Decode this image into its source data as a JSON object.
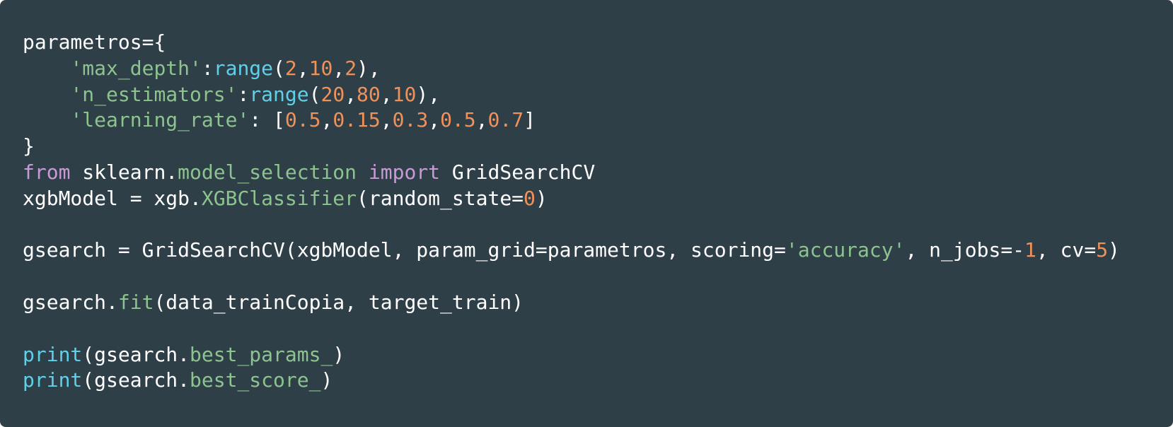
{
  "code_block": {
    "language": "python",
    "colors": {
      "background": "#2f3f48",
      "default": "#ffffff",
      "keyword": "#c99ad6",
      "string": "#8dc38f",
      "number": "#f0915a",
      "builtin": "#5fd0e8",
      "attribute": "#8dc38f"
    },
    "lines": [
      [
        {
          "t": "default",
          "text": "parametros={"
        }
      ],
      [
        {
          "t": "default",
          "text": "    "
        },
        {
          "t": "string",
          "text": "'max_depth'"
        },
        {
          "t": "default",
          "text": ":"
        },
        {
          "t": "builtin",
          "text": "range"
        },
        {
          "t": "default",
          "text": "("
        },
        {
          "t": "number",
          "text": "2"
        },
        {
          "t": "default",
          "text": ","
        },
        {
          "t": "number",
          "text": "10"
        },
        {
          "t": "default",
          "text": ","
        },
        {
          "t": "number",
          "text": "2"
        },
        {
          "t": "default",
          "text": "),"
        }
      ],
      [
        {
          "t": "default",
          "text": "    "
        },
        {
          "t": "string",
          "text": "'n_estimators'"
        },
        {
          "t": "default",
          "text": ":"
        },
        {
          "t": "builtin",
          "text": "range"
        },
        {
          "t": "default",
          "text": "("
        },
        {
          "t": "number",
          "text": "20"
        },
        {
          "t": "default",
          "text": ","
        },
        {
          "t": "number",
          "text": "80"
        },
        {
          "t": "default",
          "text": ","
        },
        {
          "t": "number",
          "text": "10"
        },
        {
          "t": "default",
          "text": "),"
        }
      ],
      [
        {
          "t": "default",
          "text": "    "
        },
        {
          "t": "string",
          "text": "'learning_rate'"
        },
        {
          "t": "default",
          "text": ": ["
        },
        {
          "t": "number",
          "text": "0.5"
        },
        {
          "t": "default",
          "text": ","
        },
        {
          "t": "number",
          "text": "0.15"
        },
        {
          "t": "default",
          "text": ","
        },
        {
          "t": "number",
          "text": "0.3"
        },
        {
          "t": "default",
          "text": ","
        },
        {
          "t": "number",
          "text": "0.5"
        },
        {
          "t": "default",
          "text": ","
        },
        {
          "t": "number",
          "text": "0.7"
        },
        {
          "t": "default",
          "text": "]"
        }
      ],
      [
        {
          "t": "default",
          "text": "}"
        }
      ],
      [
        {
          "t": "keyword",
          "text": "from"
        },
        {
          "t": "default",
          "text": " sklearn."
        },
        {
          "t": "attr",
          "text": "model_selection"
        },
        {
          "t": "default",
          "text": " "
        },
        {
          "t": "keyword",
          "text": "import"
        },
        {
          "t": "default",
          "text": " GridSearchCV"
        }
      ],
      [
        {
          "t": "default",
          "text": "xgbModel = xgb."
        },
        {
          "t": "attr",
          "text": "XGBClassifier"
        },
        {
          "t": "default",
          "text": "(random_state="
        },
        {
          "t": "number",
          "text": "0"
        },
        {
          "t": "default",
          "text": ")"
        }
      ],
      [],
      [
        {
          "t": "default",
          "text": "gsearch = GridSearchCV(xgbModel, param_grid=parametros, scoring="
        },
        {
          "t": "string",
          "text": "'accuracy'"
        },
        {
          "t": "default",
          "text": ", n_jobs=-"
        },
        {
          "t": "number",
          "text": "1"
        },
        {
          "t": "default",
          "text": ", cv="
        },
        {
          "t": "number",
          "text": "5"
        },
        {
          "t": "default",
          "text": ")"
        }
      ],
      [],
      [
        {
          "t": "default",
          "text": "gsearch."
        },
        {
          "t": "attr",
          "text": "fit"
        },
        {
          "t": "default",
          "text": "(data_trainCopia, target_train)"
        }
      ],
      [],
      [
        {
          "t": "builtin",
          "text": "print"
        },
        {
          "t": "default",
          "text": "(gsearch."
        },
        {
          "t": "attr",
          "text": "best_params_"
        },
        {
          "t": "default",
          "text": ")"
        }
      ],
      [
        {
          "t": "builtin",
          "text": "print"
        },
        {
          "t": "default",
          "text": "(gsearch."
        },
        {
          "t": "attr",
          "text": "best_score_"
        },
        {
          "t": "default",
          "text": ")"
        }
      ]
    ]
  }
}
